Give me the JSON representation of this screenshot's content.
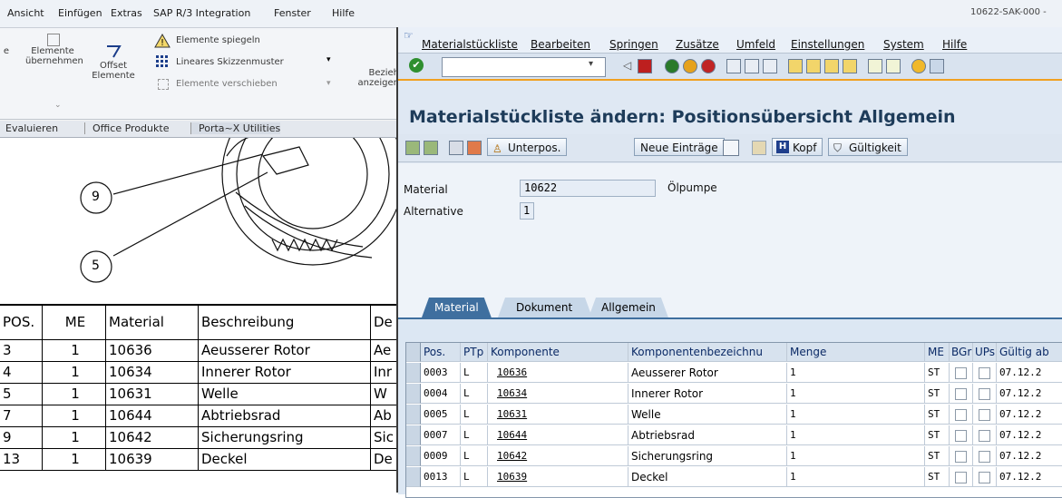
{
  "cad": {
    "menu": [
      "Ansicht",
      "Einfügen",
      "Extras",
      "SAP R/3 Integration",
      "Fenster",
      "Hilfe"
    ],
    "doc_ref": "10622-SAK-000 -",
    "ribbon": {
      "e_label": "e",
      "elements_take": "Elemente\nübernehmen",
      "offset": "Offset\nElemente",
      "mirror": "Elemente spiegeln",
      "linear": "Lineares Skizzenmuster",
      "move": "Elemente verschieben",
      "relations": "Bezieh\nanzeigen"
    },
    "tabs": [
      "Evaluieren",
      "Office Produkte",
      "Porta~X Utilities"
    ],
    "balloons": [
      "9",
      "5"
    ],
    "table": {
      "headers": [
        "POS.",
        "ME",
        "Material",
        "Beschreibung",
        "De"
      ],
      "rows": [
        [
          "3",
          "1",
          "10636",
          "Aeusserer Rotor",
          "Ae"
        ],
        [
          "4",
          "1",
          "10634",
          "Innerer Rotor",
          "Inr"
        ],
        [
          "5",
          "1",
          "10631",
          "Welle",
          "W"
        ],
        [
          "7",
          "1",
          "10644",
          "Abtriebsrad",
          "Ab"
        ],
        [
          "9",
          "1",
          "10642",
          "Sicherungsring",
          "Sic"
        ],
        [
          "13",
          "1",
          "10639",
          "Deckel",
          "De"
        ]
      ]
    }
  },
  "sap": {
    "menu": [
      "Materialstückliste",
      "Bearbeiten",
      "Springen",
      "Zusätze",
      "Umfeld",
      "Einstellungen",
      "System",
      "Hilfe"
    ],
    "command_value": "",
    "title": "Materialstückliste ändern: Positionsübersicht Allgemein",
    "toolbar": {
      "subitems": "Unterpos.",
      "new_entries": "Neue Einträge",
      "header": "Kopf",
      "validity": "Gültigkeit"
    },
    "form": {
      "material_label": "Material",
      "material_value": "10622",
      "material_desc": "Ölpumpe",
      "alternative_label": "Alternative",
      "alternative_value": "1"
    },
    "tabs": [
      "Material",
      "Dokument",
      "Allgemein"
    ],
    "grid": {
      "headers": [
        "Pos.",
        "PTp",
        "Komponente",
        "Komponentenbezeichnu",
        "Menge",
        "ME",
        "BGr",
        "UPs",
        "Gültig ab"
      ],
      "rows": [
        {
          "pos": "0003",
          "ptp": "L",
          "comp": "10636",
          "desc": "Aeusserer Rotor",
          "qty": "1",
          "me": "ST",
          "valid": "07.12.2"
        },
        {
          "pos": "0004",
          "ptp": "L",
          "comp": "10634",
          "desc": "Innerer Rotor",
          "qty": "1",
          "me": "ST",
          "valid": "07.12.2"
        },
        {
          "pos": "0005",
          "ptp": "L",
          "comp": "10631",
          "desc": "Welle",
          "qty": "1",
          "me": "ST",
          "valid": "07.12.2"
        },
        {
          "pos": "0007",
          "ptp": "L",
          "comp": "10644",
          "desc": "Abtriebsrad",
          "qty": "1",
          "me": "ST",
          "valid": "07.12.2"
        },
        {
          "pos": "0009",
          "ptp": "L",
          "comp": "10642",
          "desc": "Sicherungsring",
          "qty": "1",
          "me": "ST",
          "valid": "07.12.2"
        },
        {
          "pos": "0013",
          "ptp": "L",
          "comp": "10639",
          "desc": "Deckel",
          "qty": "1",
          "me": "ST",
          "valid": "07.12.2"
        }
      ]
    }
  }
}
